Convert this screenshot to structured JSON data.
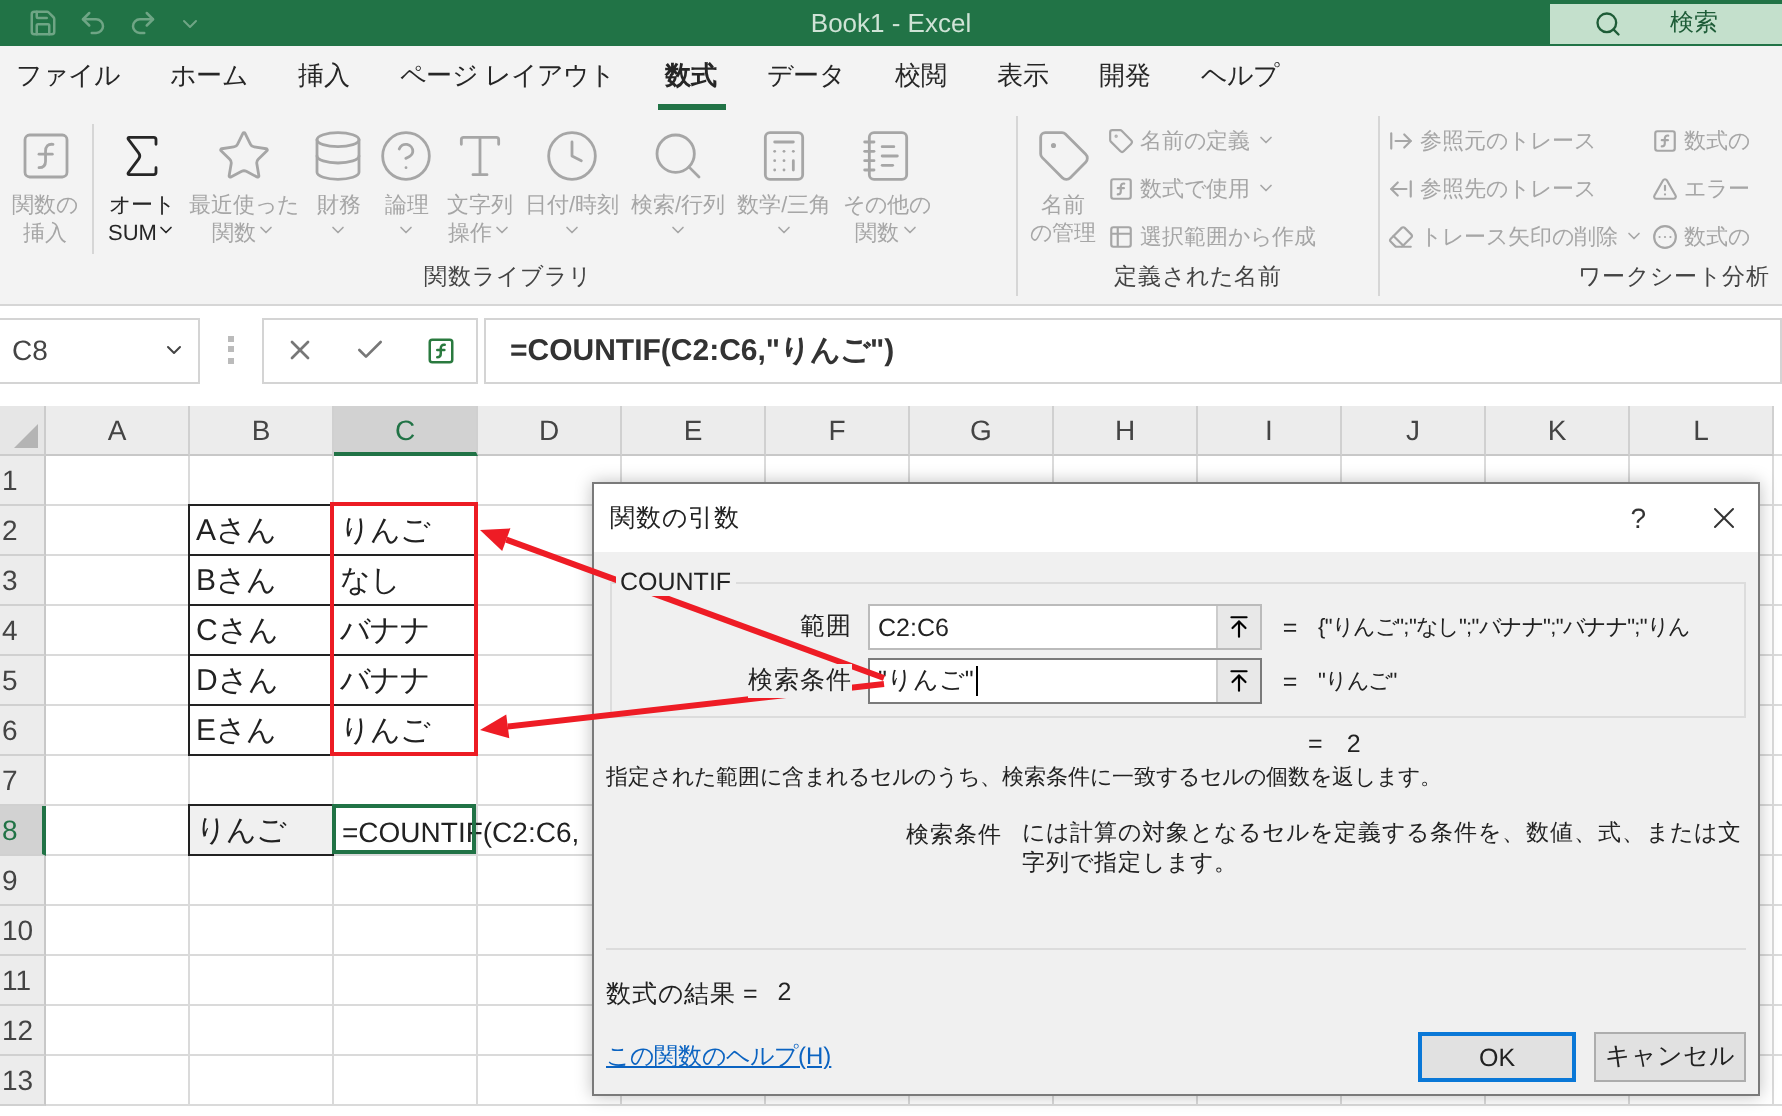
{
  "title_bar": {
    "title": "Book1  -  Excel",
    "search_placeholder": "検索"
  },
  "menu_tabs": [
    {
      "label": "ファイル",
      "selected": false
    },
    {
      "label": "ホーム",
      "selected": false
    },
    {
      "label": "挿入",
      "selected": false
    },
    {
      "label": "ページ レイアウト",
      "selected": false
    },
    {
      "label": "数式",
      "selected": true
    },
    {
      "label": "データ",
      "selected": false
    },
    {
      "label": "校閲",
      "selected": false
    },
    {
      "label": "表示",
      "selected": false
    },
    {
      "label": "開発",
      "selected": false
    },
    {
      "label": "ヘルプ",
      "selected": false
    }
  ],
  "ribbon": {
    "function_library": {
      "label": "関数ライブラリ",
      "buttons": [
        {
          "lines": [
            "関数の",
            "挿入"
          ],
          "dropdown": false,
          "disabled": true
        },
        {
          "lines": [
            "オート",
            "SUM"
          ],
          "dropdown": true,
          "disabled": false
        },
        {
          "lines": [
            "最近使った",
            "関数"
          ],
          "dropdown": true,
          "disabled": true
        },
        {
          "lines": [
            "財務"
          ],
          "dropdown": true,
          "disabled": true
        },
        {
          "lines": [
            "論理"
          ],
          "dropdown": true,
          "disabled": true
        },
        {
          "lines": [
            "文字列",
            "操作"
          ],
          "dropdown": true,
          "disabled": true
        },
        {
          "lines": [
            "日付/時刻"
          ],
          "dropdown": true,
          "disabled": true
        },
        {
          "lines": [
            "検索/行列"
          ],
          "dropdown": true,
          "disabled": true
        },
        {
          "lines": [
            "数学/三角"
          ],
          "dropdown": true,
          "disabled": true
        },
        {
          "lines": [
            "その他の",
            "関数"
          ],
          "dropdown": true,
          "disabled": true
        }
      ]
    },
    "defined_names": {
      "label": "定義された名前",
      "large_button": {
        "lines": [
          "名前",
          "の管理"
        ],
        "disabled": true
      },
      "items": [
        {
          "label": "名前の定義",
          "dropdown": true,
          "disabled": true
        },
        {
          "label": "数式で使用",
          "dropdown": true,
          "disabled": true
        },
        {
          "label": "選択範囲から作成",
          "dropdown": false,
          "disabled": true
        }
      ]
    },
    "formula_auditing": {
      "label": "ワークシート分析",
      "items": [
        {
          "label": "参照元のトレース",
          "dropdown": false,
          "disabled": true
        },
        {
          "label": "参照先のトレース",
          "dropdown": false,
          "disabled": true
        },
        {
          "label": "トレース矢印の削除",
          "dropdown": true,
          "disabled": true
        },
        {
          "label": "数式の",
          "dropdown": false,
          "disabled": true
        },
        {
          "label": "エラー",
          "dropdown": false,
          "disabled": true
        },
        {
          "label": "数式の",
          "dropdown": false,
          "disabled": true
        }
      ]
    }
  },
  "formula_bar": {
    "name_box": "C8",
    "formula": "=COUNTIF(C2:C6,\"りんご\")"
  },
  "sheet": {
    "columns": [
      {
        "label": "A",
        "selected": false
      },
      {
        "label": "B",
        "selected": false
      },
      {
        "label": "C",
        "selected": true
      },
      {
        "label": "D",
        "selected": false
      },
      {
        "label": "E",
        "selected": false
      },
      {
        "label": "F",
        "selected": false
      },
      {
        "label": "G",
        "selected": false
      },
      {
        "label": "H",
        "selected": false
      },
      {
        "label": "I",
        "selected": false
      },
      {
        "label": "J",
        "selected": false
      },
      {
        "label": "K",
        "selected": false
      },
      {
        "label": "L",
        "selected": false
      }
    ],
    "rows": [
      {
        "label": "1",
        "selected": false
      },
      {
        "label": "2",
        "selected": false
      },
      {
        "label": "3",
        "selected": false
      },
      {
        "label": "4",
        "selected": false
      },
      {
        "label": "5",
        "selected": false
      },
      {
        "label": "6",
        "selected": false
      },
      {
        "label": "7",
        "selected": false
      },
      {
        "label": "8",
        "selected": true
      },
      {
        "label": "9",
        "selected": false
      },
      {
        "label": "10",
        "selected": false
      },
      {
        "label": "11",
        "selected": false
      },
      {
        "label": "12",
        "selected": false
      },
      {
        "label": "13",
        "selected": false
      }
    ],
    "table": [
      {
        "name": "Aさん",
        "fruit": "りんご"
      },
      {
        "name": "Bさん",
        "fruit": "なし"
      },
      {
        "name": "Cさん",
        "fruit": "バナナ"
      },
      {
        "name": "Dさん",
        "fruit": "バナナ"
      },
      {
        "name": "Eさん",
        "fruit": "りんご"
      }
    ],
    "lookup": {
      "key": "りんご",
      "formula": "=COUNTIF(C2:C6,",
      "active": true
    },
    "annotation": {
      "outline": true,
      "arrows": [
        {
          "kind": "to_first"
        },
        {
          "kind": "to_last"
        }
      ]
    }
  },
  "dialog": {
    "title": "関数の引数",
    "help_button": "?",
    "function_name": "COUNTIF",
    "arguments": [
      {
        "label": "範囲",
        "value": "C2:C6",
        "sign": "=",
        "result": "{\"りんご\";\"なし\";\"バナナ\";\"バナナ\";\"りん",
        "focused": false
      },
      {
        "label": "検索条件",
        "value": "\"りんご\"",
        "sign": "=",
        "result": "\"りんご\"",
        "focused": true
      }
    ],
    "total": {
      "sign": "=",
      "value": "2"
    },
    "description": "指定された範囲に含まれるセルのうち、検索条件に一致するセルの個数を返します。",
    "argument_help": {
      "label": "検索条件",
      "text": "には計算の対象となるセルを定義する条件を、数値、式、または文字列で指定します。"
    },
    "formula_result": {
      "label": "数式の結果 =",
      "value": "2"
    },
    "help_link": "この関数のヘルプ(H)",
    "buttons": [
      {
        "label": "OK",
        "default": true
      },
      {
        "label": "キャンセル",
        "default": false
      }
    ]
  }
}
